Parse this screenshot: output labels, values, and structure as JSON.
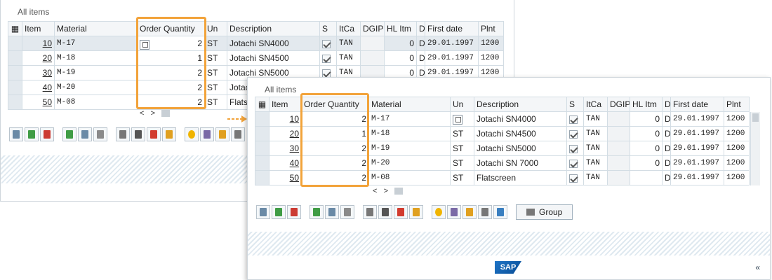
{
  "section_title": "All items",
  "back_table": {
    "headers": [
      "Item",
      "Material",
      "Order Quantity",
      "Un",
      "Description",
      "S",
      "ItCa",
      "DGIP",
      "HL Itm",
      "D",
      "First date",
      "Plnt"
    ],
    "rows": [
      {
        "item": "10",
        "material": "M-17",
        "qty": "2",
        "un": "ST",
        "desc": "Jotachi SN4000",
        "itca": "TAN",
        "hl": "0",
        "d": "D",
        "date": "29.01.1997",
        "plnt": "1200"
      },
      {
        "item": "20",
        "material": "M-18",
        "qty": "1",
        "un": "ST",
        "desc": "Jotachi SN4500",
        "itca": "TAN",
        "hl": "0",
        "d": "D",
        "date": "29.01.1997",
        "plnt": "1200"
      },
      {
        "item": "30",
        "material": "M-19",
        "qty": "2",
        "un": "ST",
        "desc": "Jotachi SN5000",
        "itca": "TAN",
        "hl": "0",
        "d": "D",
        "date": "29.01.1997",
        "plnt": "1200"
      },
      {
        "item": "40",
        "material": "M-20",
        "qty": "2",
        "un": "ST",
        "desc": "Jotac",
        "itca": "",
        "hl": "",
        "d": "",
        "date": "",
        "plnt": ""
      },
      {
        "item": "50",
        "material": "M-08",
        "qty": "2",
        "un": "ST",
        "desc": "Flats",
        "itca": "",
        "hl": "",
        "d": "",
        "date": "",
        "plnt": ""
      }
    ]
  },
  "front_table": {
    "headers": [
      "Item",
      "Order Quantity",
      "Material",
      "Un",
      "Description",
      "S",
      "ItCa",
      "DGIP",
      "HL Itm",
      "D",
      "First date",
      "Plnt"
    ],
    "rows": [
      {
        "item": "10",
        "qty": "2",
        "material": "M-17",
        "un": "",
        "desc": "Jotachi SN4000",
        "itca": "TAN",
        "hl": "0",
        "d": "D",
        "date": "29.01.1997",
        "plnt": "1200"
      },
      {
        "item": "20",
        "qty": "1",
        "material": "M-18",
        "un": "ST",
        "desc": "Jotachi SN4500",
        "itca": "TAN",
        "hl": "0",
        "d": "D",
        "date": "29.01.1997",
        "plnt": "1200"
      },
      {
        "item": "30",
        "qty": "2",
        "material": "M-19",
        "un": "ST",
        "desc": "Jotachi SN5000",
        "itca": "TAN",
        "hl": "0",
        "d": "D",
        "date": "29.01.1997",
        "plnt": "1200"
      },
      {
        "item": "40",
        "qty": "2",
        "material": "M-20",
        "un": "ST",
        "desc": "Jotachi SN 7000",
        "itca": "TAN",
        "hl": "0",
        "d": "D",
        "date": "29.01.1997",
        "plnt": "1200"
      },
      {
        "item": "50",
        "qty": "2",
        "material": "M-08",
        "un": "ST",
        "desc": "Flatscreen",
        "itca": "TAN",
        "hl": "",
        "d": "D",
        "date": "29.01.1997",
        "plnt": "1200"
      }
    ]
  },
  "nav": {
    "left": "<",
    "right": ">"
  },
  "group_button_label": "Group",
  "sap_logo_text": "SAP",
  "collapse_label": "«",
  "colors": {
    "highlight": "#f2a33a",
    "arrow": "#f2a33a",
    "sap_blue": "#0a4d95"
  },
  "icons": [
    "details-icon",
    "insert-row-icon",
    "delete-row-icon",
    "select-all-icon",
    "select-block-icon",
    "deselect-icon",
    "configure-icon",
    "split-icon",
    "pdf-icon",
    "chart-icon",
    "pricing-icon",
    "flask-icon",
    "edit-icon",
    "settings-icon",
    "structure-icon"
  ]
}
